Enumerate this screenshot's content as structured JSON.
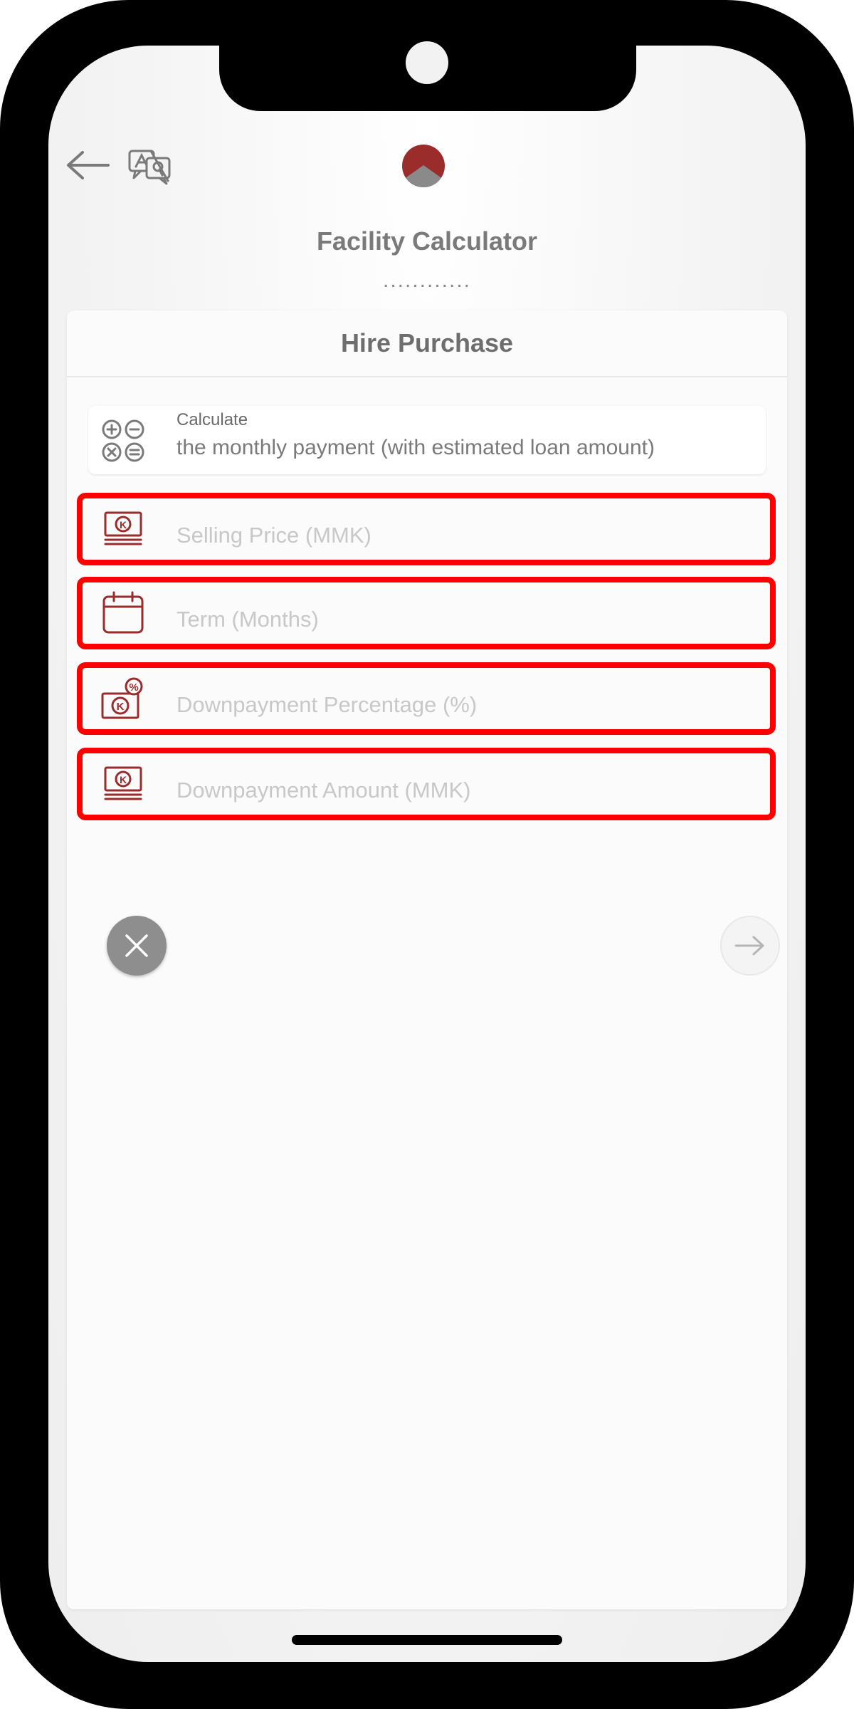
{
  "header": {
    "back_icon": "arrow-left-icon",
    "language_icon": "translate-icon",
    "logo_icon": "brand-logo-icon",
    "title": "Facility Calculator",
    "dots": "............"
  },
  "card": {
    "title": "Hire Purchase",
    "calculate": {
      "label": "Calculate",
      "value": "the monthly payment (with estimated loan amount)",
      "icon": "calculator-operators-icon"
    },
    "fields": [
      {
        "placeholder": "Selling Price (MMK)",
        "icon": "banknote-kyat-icon"
      },
      {
        "placeholder": "Term (Months)",
        "icon": "calendar-icon"
      },
      {
        "placeholder": "Downpayment Percentage (%)",
        "icon": "kyat-percentage-icon"
      },
      {
        "placeholder": "Downpayment Amount (MMK)",
        "icon": "banknote-kyat-icon"
      }
    ]
  },
  "actions": {
    "clear_icon": "close-icon",
    "next_icon": "arrow-right-icon"
  },
  "colors": {
    "accent": "#9b2c2c",
    "highlight": "#ff0000",
    "text_muted": "#c8c8c8"
  }
}
